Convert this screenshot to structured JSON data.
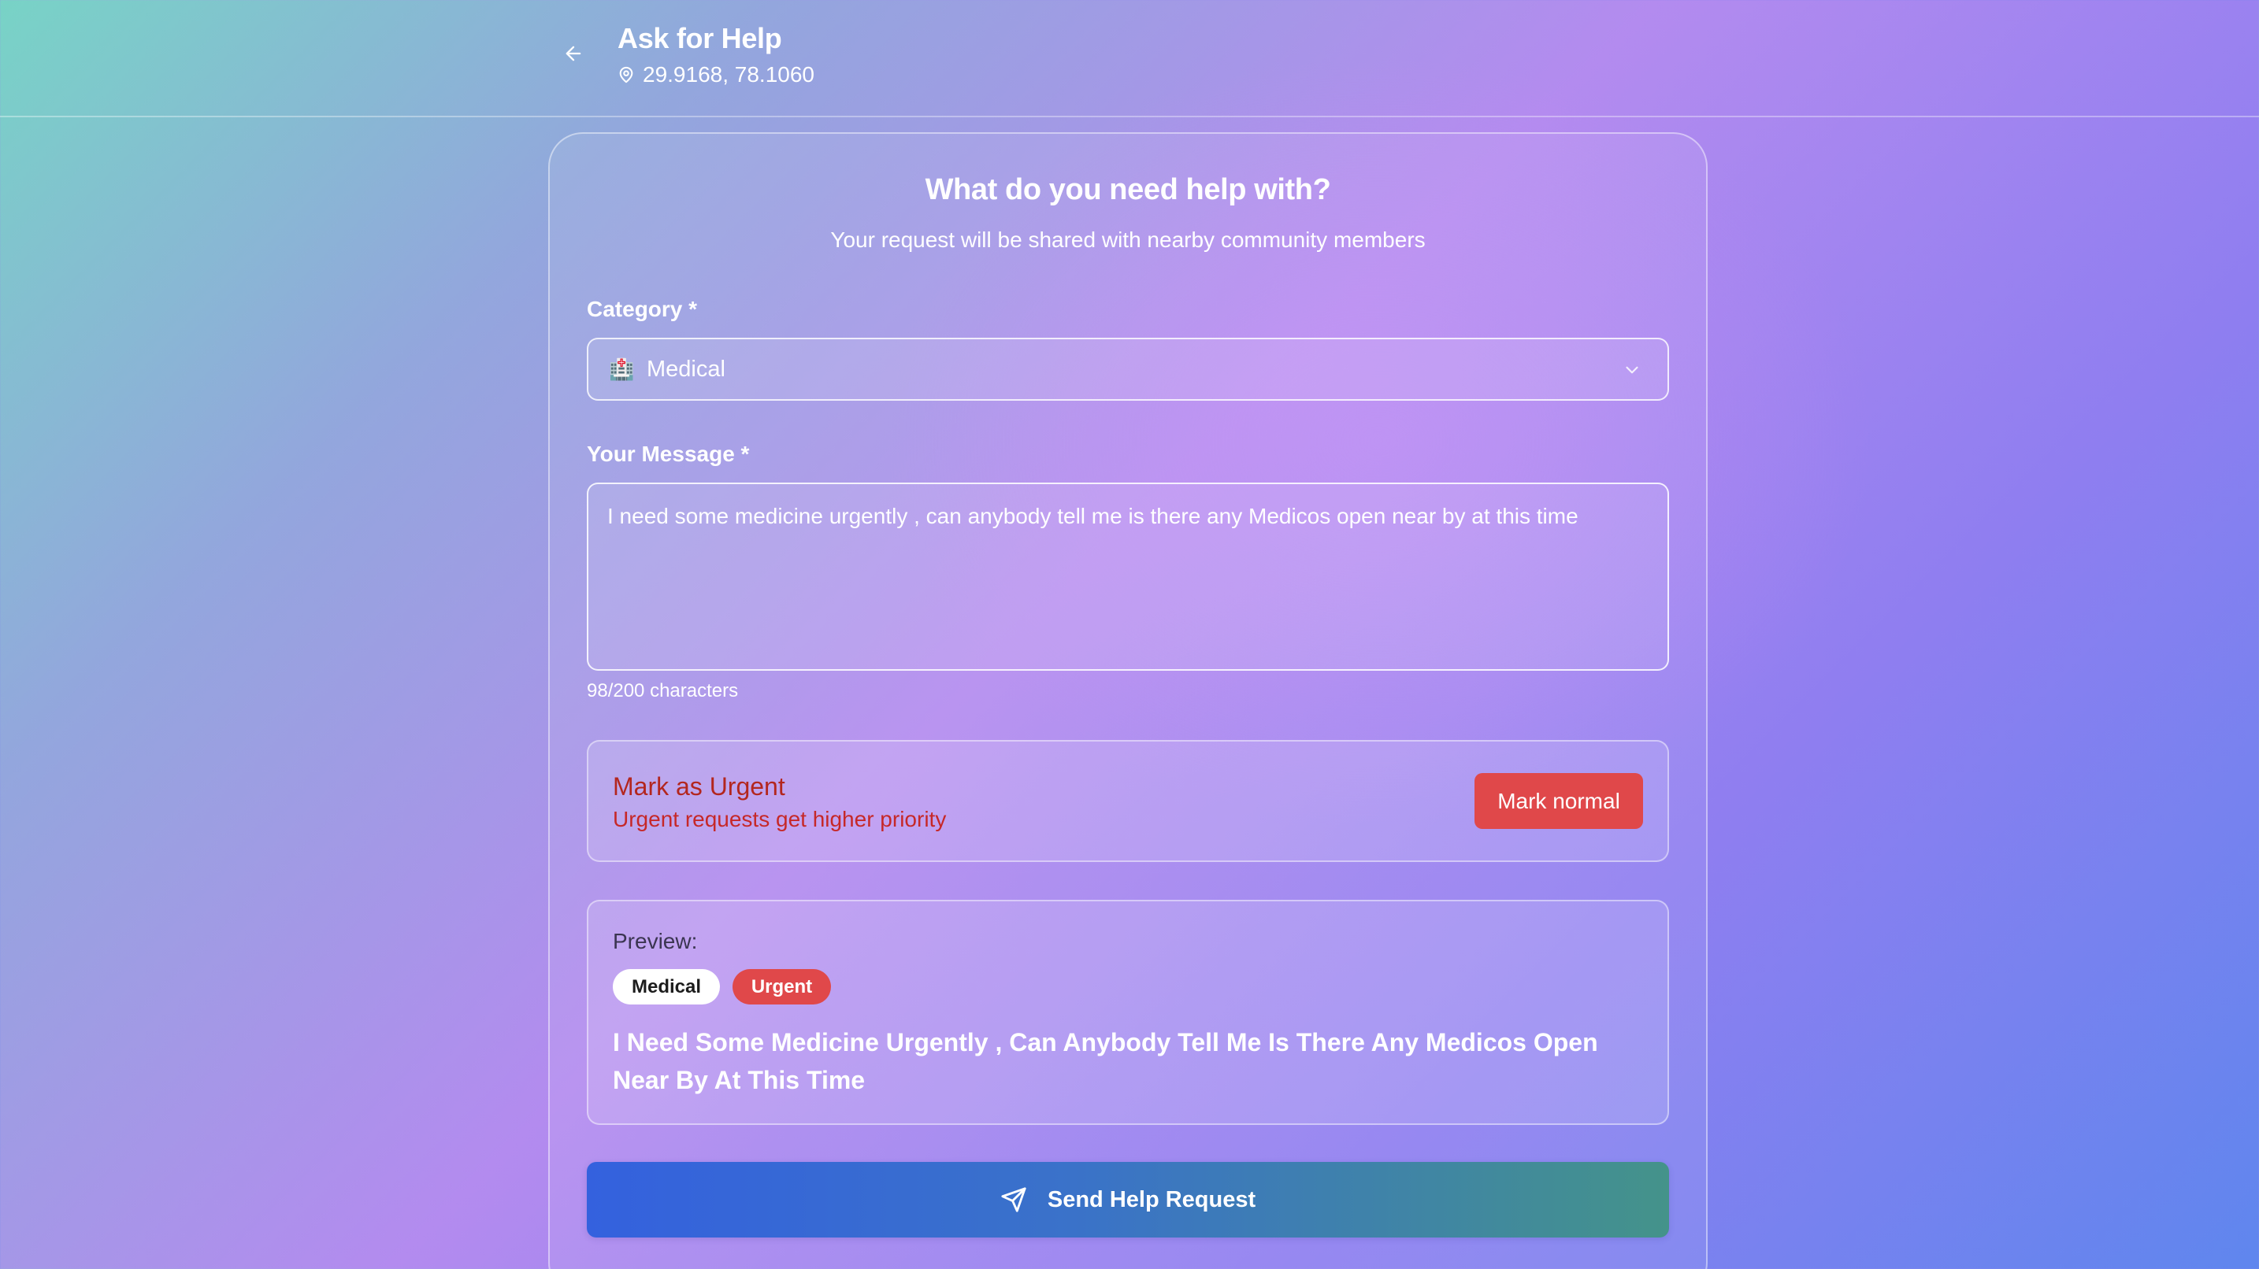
{
  "header": {
    "title": "Ask for Help",
    "coordinates": "29.9168, 78.1060",
    "back_icon": "arrow-left-icon",
    "location_icon": "map-pin-icon"
  },
  "form": {
    "title": "What do you need help with?",
    "subtitle": "Your request will be shared with nearby community members",
    "category": {
      "label": "Category *",
      "icon": "hospital-emoji",
      "emoji": "🏥",
      "value": "Medical"
    },
    "message": {
      "label": "Your Message *",
      "value": "I need some medicine urgently , can anybody tell me is there any Medicos open near by at this time",
      "char_count": "98/200 characters"
    },
    "urgent": {
      "title": "Mark as Urgent",
      "subtitle": "Urgent requests get higher priority",
      "button_label": "Mark normal"
    },
    "preview": {
      "label": "Preview:",
      "category_tag": "Medical",
      "urgent_tag": "Urgent",
      "text": "I Need Some Medicine Urgently , Can Anybody Tell Me Is There Any Medicos Open Near By At This Time"
    },
    "submit": {
      "label": "Send Help Request",
      "icon": "send-icon"
    }
  },
  "colors": {
    "urgent_red": "#e0484a",
    "send_gradient_start": "#3461de",
    "send_gradient_end": "#44938a"
  }
}
